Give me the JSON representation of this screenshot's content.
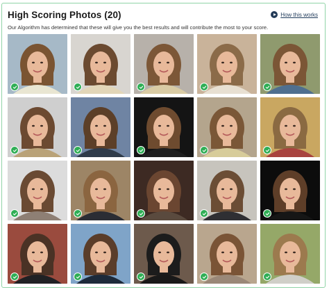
{
  "header": {
    "title": "High Scoring Photos (20)",
    "subtitle": "Our Algorithm has determined that these will give you the best results and will contribute the most to your score.",
    "how_link": "How this works"
  },
  "photos": [
    {
      "bg": "#a6b9c7",
      "hair": "#7a5432",
      "shirt": "#e9e6d2"
    },
    {
      "bg": "#d8d5d0",
      "hair": "#6b4a30",
      "shirt": "#e2d6b8"
    },
    {
      "bg": "#b7b1aa",
      "hair": "#7c5737",
      "shirt": "#d9cba4"
    },
    {
      "bg": "#c9b39a",
      "hair": "#8b6b49",
      "shirt": "#e8e0d2"
    },
    {
      "bg": "#8f9a6e",
      "hair": "#7b5636",
      "shirt": "#4f6f8f"
    },
    {
      "bg": "#cfcfcf",
      "hair": "#6c4a31",
      "shirt": "#b9a278"
    },
    {
      "bg": "#6f84a3",
      "hair": "#5c3f28",
      "shirt": "#2f3b4a"
    },
    {
      "bg": "#141414",
      "hair": "#6e4b2f",
      "shirt": "#1f1f1f"
    },
    {
      "bg": "#b4a58d",
      "hair": "#7a5737",
      "shirt": "#d7cc9a"
    },
    {
      "bg": "#c9a761",
      "hair": "#8a6a42",
      "shirt": "#a8433f"
    },
    {
      "bg": "#dcdcdc",
      "hair": "#6a4a33",
      "shirt": "#8e7f74"
    },
    {
      "bg": "#9d8566",
      "hair": "#8b6540",
      "shirt": "#2b2d34"
    },
    {
      "bg": "#3d2a23",
      "hair": "#6b4631",
      "shirt": "#5a4a3e"
    },
    {
      "bg": "#c7c4bd",
      "hair": "#6b4d35",
      "shirt": "#2f2f33"
    },
    {
      "bg": "#0c0c0c",
      "hair": "#5e3e28",
      "shirt": "#161616"
    },
    {
      "bg": "#9a4b3e",
      "hair": "#4a3225",
      "shirt": "#202124"
    },
    {
      "bg": "#7fa4c8",
      "hair": "#5a3d2a",
      "shirt": "#1d2a3a"
    },
    {
      "bg": "#6d5a4c",
      "hair": "#1c1c1c",
      "shirt": "#191919"
    },
    {
      "bg": "#b9a68e",
      "hair": "#7a5436",
      "shirt": "#9a8878"
    },
    {
      "bg": "#95a868",
      "hair": "#9c7a4e",
      "shirt": "#d0cfc8"
    }
  ],
  "colors": {
    "border": "#8fd3a6",
    "check": "#2fae55",
    "skin": "#e8b99a",
    "link": "#1f3a5a"
  },
  "icons": {
    "how_link_icon": "play-circle-icon",
    "photo_badge": "check-circle-icon"
  }
}
